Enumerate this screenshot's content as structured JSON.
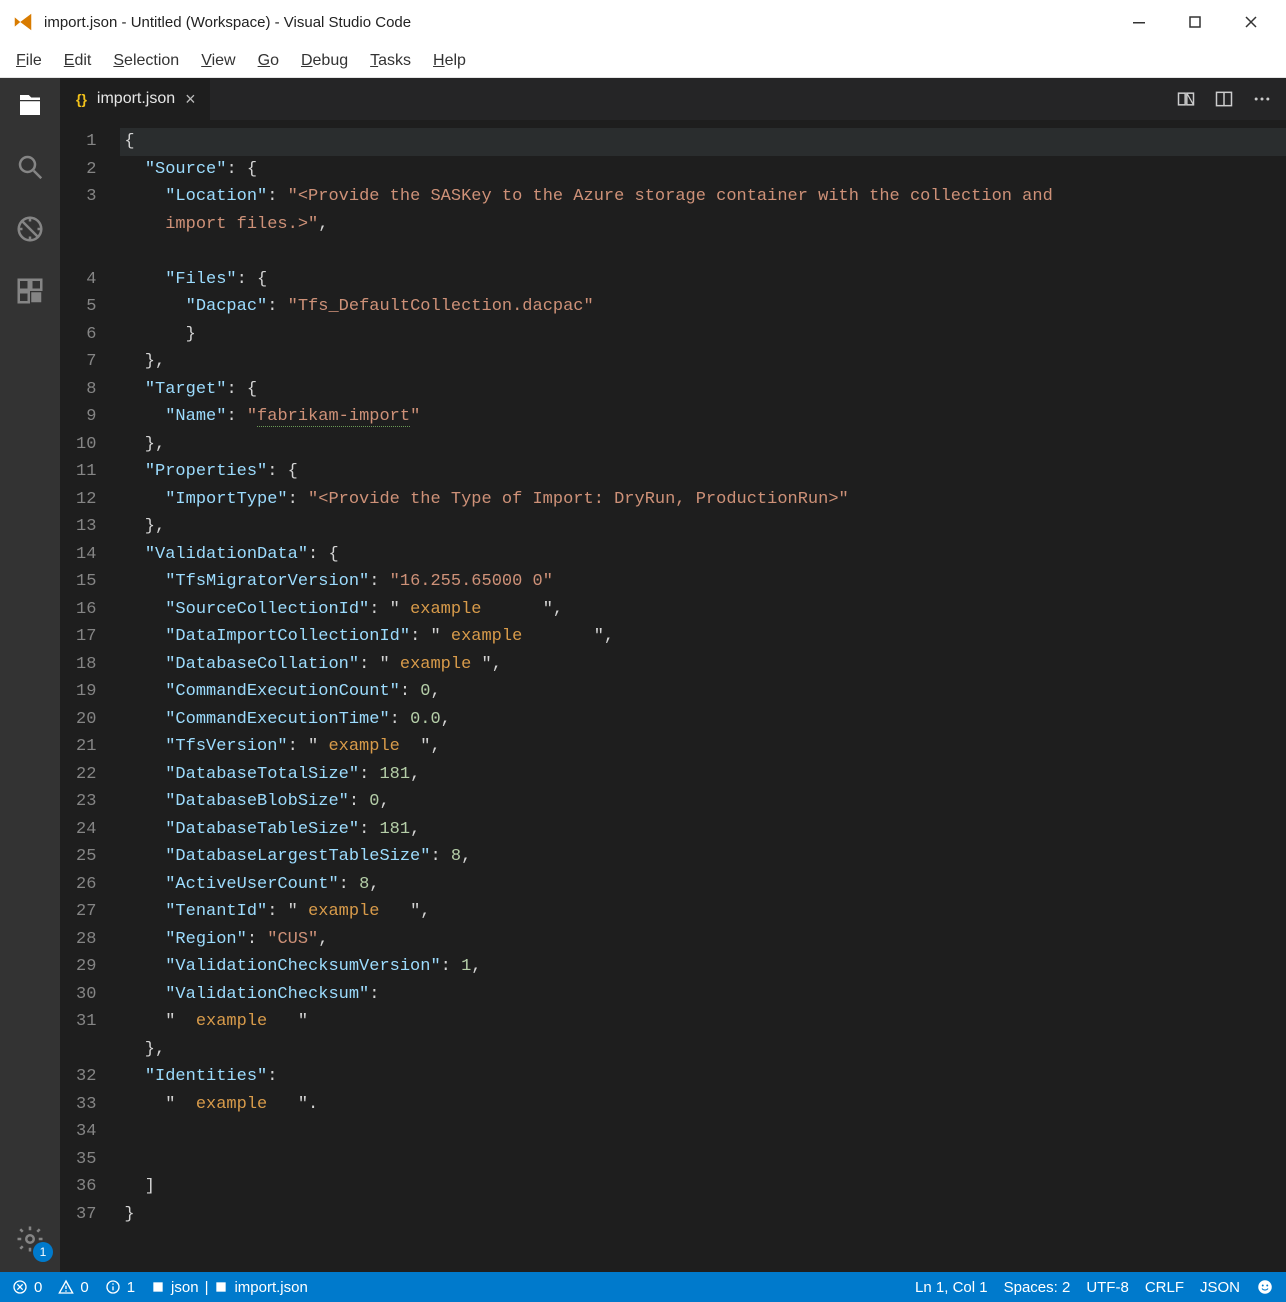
{
  "window": {
    "title": "import.json - Untitled (Workspace) - Visual Studio Code"
  },
  "menu": {
    "items": [
      {
        "label": "File",
        "ul": "F"
      },
      {
        "label": "Edit",
        "ul": "E"
      },
      {
        "label": "Selection",
        "ul": "S"
      },
      {
        "label": "View",
        "ul": "V"
      },
      {
        "label": "Go",
        "ul": "G"
      },
      {
        "label": "Debug",
        "ul": "D"
      },
      {
        "label": "Tasks",
        "ul": "T"
      },
      {
        "label": "Help",
        "ul": "H"
      }
    ]
  },
  "activity": {
    "settings_badge": "1"
  },
  "tab": {
    "icon": "{}",
    "name": "import.json",
    "close": "×"
  },
  "editor": {
    "lines": [
      {
        "n": "1",
        "indent": 0,
        "hl": true,
        "spans": [
          {
            "t": "{",
            "c": ""
          }
        ]
      },
      {
        "n": "2",
        "indent": 1,
        "spans": [
          {
            "t": "\"Source\"",
            "c": "c-key"
          },
          {
            "t": ": {",
            "c": ""
          }
        ]
      },
      {
        "n": "3",
        "indent": 2,
        "spans": [
          {
            "t": "\"Location\"",
            "c": "c-key"
          },
          {
            "t": ": ",
            "c": ""
          },
          {
            "t": "\"<Provide the SASKey to the Azure storage container with the collection and",
            "c": "c-str"
          }
        ]
      },
      {
        "n": "",
        "indent": 2,
        "spans": [
          {
            "t": "import files.>\"",
            "c": "c-str"
          },
          {
            "t": ",",
            "c": ""
          }
        ]
      },
      {
        "n": "",
        "indent": 0,
        "spans": [
          {
            "t": "",
            "c": ""
          }
        ]
      },
      {
        "n": "4",
        "indent": 2,
        "spans": [
          {
            "t": "\"Files\"",
            "c": "c-key"
          },
          {
            "t": ": {",
            "c": ""
          }
        ]
      },
      {
        "n": "5",
        "indent": 3,
        "spans": [
          {
            "t": "\"Dacpac\"",
            "c": "c-key"
          },
          {
            "t": ": ",
            "c": ""
          },
          {
            "t": "\"Tfs_DefaultCollection.dacpac\"",
            "c": "c-str"
          }
        ]
      },
      {
        "n": "6",
        "indent": 3,
        "spans": [
          {
            "t": "}",
            "c": ""
          }
        ]
      },
      {
        "n": "7",
        "indent": 1,
        "spans": [
          {
            "t": "},",
            "c": ""
          }
        ]
      },
      {
        "n": "8",
        "indent": 1,
        "spans": [
          {
            "t": "\"Target\"",
            "c": "c-key"
          },
          {
            "t": ": {",
            "c": ""
          }
        ]
      },
      {
        "n": "9",
        "indent": 2,
        "spans": [
          {
            "t": "\"Name\"",
            "c": "c-key"
          },
          {
            "t": ": ",
            "c": ""
          },
          {
            "t": "\"",
            "c": "c-str"
          },
          {
            "t": "fabrikam-import",
            "c": "c-str c-squig"
          },
          {
            "t": "\"",
            "c": "c-str"
          }
        ]
      },
      {
        "n": "10",
        "indent": 1,
        "spans": [
          {
            "t": "},",
            "c": ""
          }
        ]
      },
      {
        "n": "11",
        "indent": 1,
        "spans": [
          {
            "t": "\"Properties\"",
            "c": "c-key"
          },
          {
            "t": ": {",
            "c": ""
          }
        ]
      },
      {
        "n": "12",
        "indent": 2,
        "spans": [
          {
            "t": "\"ImportType\"",
            "c": "c-key"
          },
          {
            "t": ": ",
            "c": ""
          },
          {
            "t": "\"<Provide the Type of Import: DryRun, ProductionRun>\"",
            "c": "c-str"
          }
        ]
      },
      {
        "n": "13",
        "indent": 1,
        "spans": [
          {
            "t": "},",
            "c": ""
          }
        ]
      },
      {
        "n": "14",
        "indent": 1,
        "spans": [
          {
            "t": "\"ValidationData\"",
            "c": "c-key"
          },
          {
            "t": ": {",
            "c": ""
          }
        ]
      },
      {
        "n": "15",
        "indent": 2,
        "spans": [
          {
            "t": "\"TfsMigratorVersion\"",
            "c": "c-key"
          },
          {
            "t": ": ",
            "c": ""
          },
          {
            "t": "\"16.255.65000 ",
            "c": "c-str"
          },
          {
            "t": "0",
            "c": "c-str"
          },
          {
            "t": "\"",
            "c": "c-str"
          }
        ]
      },
      {
        "n": "16",
        "indent": 2,
        "spans": [
          {
            "t": "\"SourceCollectionId\"",
            "c": "c-key"
          },
          {
            "t": ": \" ",
            "c": ""
          },
          {
            "t": "example",
            "c": "c-eg"
          },
          {
            "t": "      \",",
            "c": ""
          }
        ]
      },
      {
        "n": "17",
        "indent": 2,
        "spans": [
          {
            "t": "\"DataImportCollectionId\"",
            "c": "c-key"
          },
          {
            "t": ": \" ",
            "c": ""
          },
          {
            "t": "example",
            "c": "c-eg"
          },
          {
            "t": "       \",",
            "c": ""
          }
        ]
      },
      {
        "n": "18",
        "indent": 2,
        "spans": [
          {
            "t": "\"DatabaseCollation\"",
            "c": "c-key"
          },
          {
            "t": ": \" ",
            "c": ""
          },
          {
            "t": "example",
            "c": "c-eg"
          },
          {
            "t": " \",",
            "c": ""
          }
        ]
      },
      {
        "n": "19",
        "indent": 2,
        "spans": [
          {
            "t": "\"CommandExecutionCount\"",
            "c": "c-key"
          },
          {
            "t": ": ",
            "c": ""
          },
          {
            "t": "0",
            "c": "c-num"
          },
          {
            "t": ",",
            "c": ""
          }
        ]
      },
      {
        "n": "20",
        "indent": 2,
        "spans": [
          {
            "t": "\"CommandExecutionTime\"",
            "c": "c-key"
          },
          {
            "t": ": ",
            "c": ""
          },
          {
            "t": "0.0",
            "c": "c-num"
          },
          {
            "t": ",",
            "c": ""
          }
        ]
      },
      {
        "n": "21",
        "indent": 2,
        "spans": [
          {
            "t": "\"TfsVersion\"",
            "c": "c-key"
          },
          {
            "t": ": \" ",
            "c": ""
          },
          {
            "t": "example",
            "c": "c-eg"
          },
          {
            "t": "  \",",
            "c": ""
          }
        ]
      },
      {
        "n": "22",
        "indent": 2,
        "spans": [
          {
            "t": "\"DatabaseTotalSize\"",
            "c": "c-key"
          },
          {
            "t": ": ",
            "c": ""
          },
          {
            "t": "181",
            "c": "c-num"
          },
          {
            "t": ",",
            "c": ""
          }
        ]
      },
      {
        "n": "23",
        "indent": 2,
        "spans": [
          {
            "t": "\"DatabaseBlobSize\"",
            "c": "c-key"
          },
          {
            "t": ": ",
            "c": ""
          },
          {
            "t": "0",
            "c": "c-num"
          },
          {
            "t": ",",
            "c": ""
          }
        ]
      },
      {
        "n": "24",
        "indent": 2,
        "spans": [
          {
            "t": "\"DatabaseTableSize\"",
            "c": "c-key"
          },
          {
            "t": ": ",
            "c": ""
          },
          {
            "t": "181",
            "c": "c-num"
          },
          {
            "t": ",",
            "c": ""
          }
        ]
      },
      {
        "n": "25",
        "indent": 2,
        "spans": [
          {
            "t": "\"DatabaseLargestTableSize\"",
            "c": "c-key"
          },
          {
            "t": ": ",
            "c": ""
          },
          {
            "t": "8",
            "c": "c-num"
          },
          {
            "t": ",",
            "c": ""
          }
        ]
      },
      {
        "n": "26",
        "indent": 2,
        "spans": [
          {
            "t": "\"ActiveUserCount\"",
            "c": "c-key"
          },
          {
            "t": ": ",
            "c": ""
          },
          {
            "t": "8",
            "c": "c-num"
          },
          {
            "t": ",",
            "c": ""
          }
        ]
      },
      {
        "n": "27",
        "indent": 2,
        "spans": [
          {
            "t": "\"TenantId\"",
            "c": "c-key"
          },
          {
            "t": ": \" ",
            "c": ""
          },
          {
            "t": "example",
            "c": "c-eg"
          },
          {
            "t": "   \",",
            "c": ""
          }
        ]
      },
      {
        "n": "28",
        "indent": 2,
        "spans": [
          {
            "t": "\"Region\"",
            "c": "c-key"
          },
          {
            "t": ": ",
            "c": ""
          },
          {
            "t": "\"CUS\"",
            "c": "c-str"
          },
          {
            "t": ",",
            "c": ""
          }
        ]
      },
      {
        "n": "29",
        "indent": 2,
        "spans": [
          {
            "t": "\"ValidationChecksumVersion\"",
            "c": "c-key"
          },
          {
            "t": ": ",
            "c": ""
          },
          {
            "t": "1",
            "c": "c-num"
          },
          {
            "t": ",",
            "c": ""
          }
        ]
      },
      {
        "n": "30",
        "indent": 2,
        "spans": [
          {
            "t": "\"ValidationChecksum\"",
            "c": "c-key"
          },
          {
            "t": ":",
            "c": ""
          }
        ]
      },
      {
        "n": "31",
        "indent": 2,
        "spans": [
          {
            "t": "\"  ",
            "c": ""
          },
          {
            "t": "example",
            "c": "c-eg"
          },
          {
            "t": "   \"",
            "c": ""
          }
        ]
      },
      {
        "n": "",
        "indent": 1,
        "spans": [
          {
            "t": "},",
            "c": ""
          }
        ]
      },
      {
        "n": "32",
        "indent": 1,
        "spans": [
          {
            "t": "\"Identities\"",
            "c": "c-key"
          },
          {
            "t": ":",
            "c": ""
          }
        ]
      },
      {
        "n": "33",
        "indent": 2,
        "spans": [
          {
            "t": "\"  ",
            "c": ""
          },
          {
            "t": "example",
            "c": "c-eg"
          },
          {
            "t": "   \".",
            "c": ""
          }
        ]
      },
      {
        "n": "34",
        "indent": 0,
        "spans": [
          {
            "t": "",
            "c": ""
          }
        ]
      },
      {
        "n": "35",
        "indent": 0,
        "spans": [
          {
            "t": "",
            "c": ""
          }
        ]
      },
      {
        "n": "36",
        "indent": 1,
        "spans": [
          {
            "t": "]",
            "c": ""
          }
        ]
      },
      {
        "n": "37",
        "indent": 0,
        "spans": [
          {
            "t": "}",
            "c": ""
          }
        ]
      }
    ]
  },
  "status": {
    "errors": "0",
    "warnings": "0",
    "info": "1",
    "breadcrumb_left": "json",
    "breadcrumb_right": "import.json",
    "pos": "Ln 1, Col 1",
    "spaces": "Spaces: 2",
    "encoding": "UTF-8",
    "eol": "CRLF",
    "lang": "JSON"
  }
}
